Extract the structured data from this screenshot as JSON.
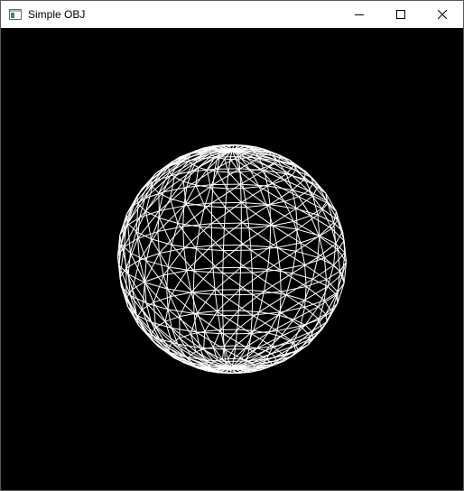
{
  "window": {
    "title": "Simple OBJ",
    "icon": "app-window-icon"
  },
  "controls": {
    "minimize_icon": "minimize-icon",
    "maximize_icon": "maximize-icon",
    "close_icon": "close-icon"
  },
  "viewport": {
    "background": "#000000",
    "render_mode": "wireframe",
    "model": "sphere",
    "line_color": "#ffffff",
    "latitude_bands": 16,
    "longitude_segments": 24
  }
}
